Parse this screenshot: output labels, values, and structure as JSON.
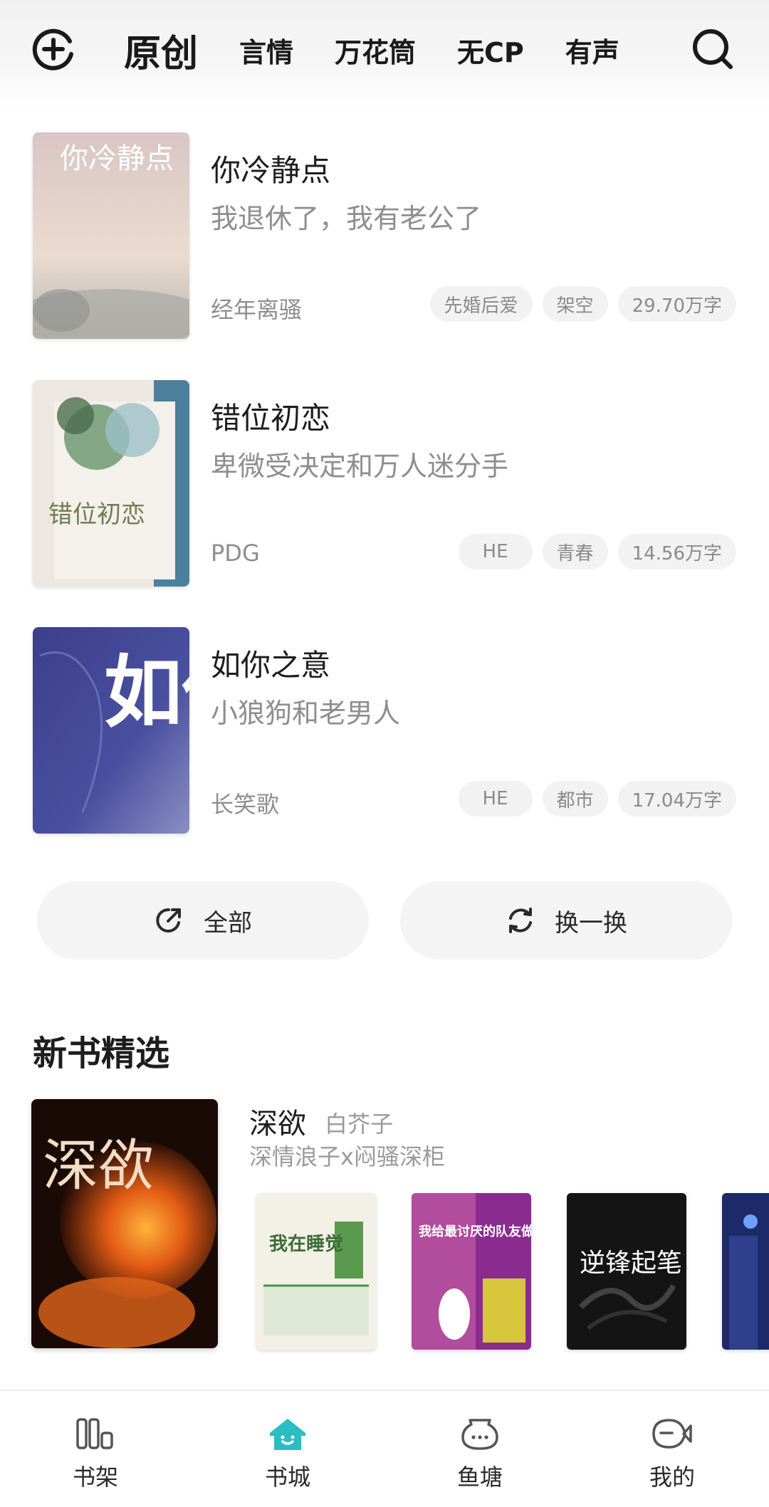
{
  "nav": {
    "tabs": [
      "原创",
      "言情",
      "万花筒",
      "无CP",
      "有声"
    ],
    "active_tab": "原创"
  },
  "books": [
    {
      "title": "你冷静点",
      "desc": "我退休了，我有老公了",
      "author": "经年离骚",
      "tags": [
        "先婚后爱",
        "架空",
        "29.70万字"
      ],
      "cover_text": "你冷静点"
    },
    {
      "title": "错位初恋",
      "desc": "卑微受决定和万人迷分手",
      "author": "PDG",
      "tags": [
        "HE",
        "青春",
        "14.56万字"
      ],
      "cover_text": "错位初恋"
    },
    {
      "title": "如你之意",
      "desc": "小狼狗和老男人",
      "author": "长笑歌",
      "tags": [
        "HE",
        "都市",
        "17.04万字"
      ],
      "cover_text": "如你"
    }
  ],
  "actions": {
    "all_label": "全部",
    "refresh_label": "换一换"
  },
  "new_books": {
    "section_title": "新书精选",
    "featured": {
      "title": "深欲",
      "author": "白芥子",
      "desc": "深情浪子x闷骚深柜",
      "cover_text": "深欲"
    },
    "mini_covers": [
      {
        "cover_text": "我在睡觉"
      },
      {
        "cover_text": "我给最讨厌的队友做狗"
      },
      {
        "cover_text": "逆锋起笔"
      },
      {
        "cover_text": ""
      }
    ]
  },
  "bottom_nav": {
    "items": [
      {
        "label": "书架",
        "icon": "bookshelf-icon",
        "active": false
      },
      {
        "label": "书城",
        "icon": "bookstore-icon",
        "active": true
      },
      {
        "label": "鱼塘",
        "icon": "fishpond-icon",
        "active": false
      },
      {
        "label": "我的",
        "icon": "profile-fish-icon",
        "active": false
      }
    ],
    "active_color": "#2bbdc4"
  }
}
